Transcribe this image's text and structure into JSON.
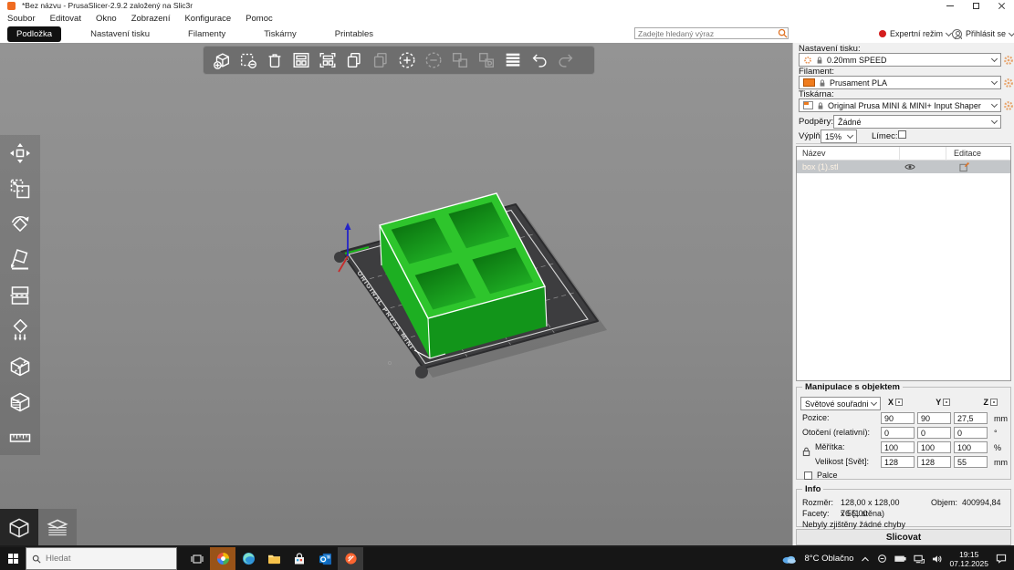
{
  "window": {
    "title": "*Bez názvu - PrusaSlicer-2.9.2 založený na Slic3r"
  },
  "menu": {
    "items": [
      "Soubor",
      "Editovat",
      "Okno",
      "Zobrazení",
      "Konfigurace",
      "Pomoc"
    ]
  },
  "tabbar": {
    "tabs": [
      "Podložka",
      "Nastavení tisku",
      "Filamenty",
      "Tiskárny",
      "Printables"
    ],
    "search_placeholder": "Zadejte hledaný výraz",
    "mode_label": "Expertní režim",
    "login_label": "Přihlásit se"
  },
  "top_toolbar": {
    "icons": [
      {
        "name": "add-object",
        "enabled": true
      },
      {
        "name": "delete-object",
        "enabled": true
      },
      {
        "name": "delete-all",
        "enabled": true
      },
      {
        "name": "arrange",
        "enabled": true
      },
      {
        "name": "arrange-bed",
        "enabled": true
      },
      {
        "name": "copy",
        "enabled": true
      },
      {
        "name": "paste",
        "enabled": false
      },
      {
        "name": "add-instance",
        "enabled": true
      },
      {
        "name": "remove-instance",
        "enabled": false
      },
      {
        "name": "split-to-objects",
        "enabled": false
      },
      {
        "name": "split-to-parts",
        "enabled": false
      },
      {
        "name": "variable-layer-height",
        "enabled": true
      },
      {
        "name": "undo",
        "enabled": true
      },
      {
        "name": "redo",
        "enabled": false
      }
    ]
  },
  "left_toolbar": {
    "icons": [
      "move",
      "scale",
      "rotate",
      "place-on-face",
      "cut",
      "paint-supports",
      "seam",
      "fuzzy-skin",
      "measure"
    ]
  },
  "viewport": {
    "bed_label": "ORIGINAL PRUSA MINI"
  },
  "sidebar": {
    "print": {
      "label": "Nastavení tisku:",
      "value": "0.20mm SPEED"
    },
    "filament": {
      "label": "Filament:",
      "value": "Prusament PLA"
    },
    "printer": {
      "label": "Tiskárna:",
      "value": "Original Prusa MINI & MINI+ Input Shaper"
    },
    "supports": {
      "label": "Podpěry:",
      "value": "Žádné"
    },
    "infill": {
      "label": "Výplň:",
      "value": "15%"
    },
    "brim": {
      "label": "Límec:"
    },
    "object_list": {
      "name_header": "Název",
      "edit_header": "Editace",
      "rows": [
        {
          "name": "box (1).stl"
        }
      ]
    },
    "manipulation": {
      "title": "Manipulace s objektem",
      "coord_system": "Světové souřadnice",
      "axes": [
        "X",
        "Y",
        "Z"
      ],
      "rows": [
        {
          "label": "Pozice:",
          "x": "90",
          "y": "90",
          "z": "27,5",
          "unit": "mm"
        },
        {
          "label": "Otočení (relativní):",
          "x": "0",
          "y": "0",
          "z": "0",
          "unit": "°"
        },
        {
          "label": "Měřítka:",
          "x": "100",
          "y": "100",
          "z": "100",
          "unit": "%"
        },
        {
          "label": "Velikost [Svět]:",
          "x": "128",
          "y": "128",
          "z": "55",
          "unit": "mm"
        }
      ],
      "inches_label": "Palce"
    },
    "info": {
      "title": "Info",
      "size_label": "Rozměr:",
      "size_value": "128,00 x 128,00 x 55,00",
      "volume_label": "Objem:",
      "volume_value": "400994,84",
      "facets_label": "Facety:",
      "facets_value": "76 (1 stěna)",
      "status": "Nebyly zjištěny žádné chyby"
    },
    "slice_label": "Slicovat"
  },
  "taskbar": {
    "search_placeholder": "Hledat",
    "tray": {
      "weather": "8°C Oblačno",
      "time": "19:15",
      "date": "07.12.2025"
    }
  },
  "colors": {
    "accent_orange": "#ef6b21",
    "model_green": "#2ec52c",
    "expert_red": "#d41d1d",
    "bed_gray": "#3d3d3f"
  }
}
